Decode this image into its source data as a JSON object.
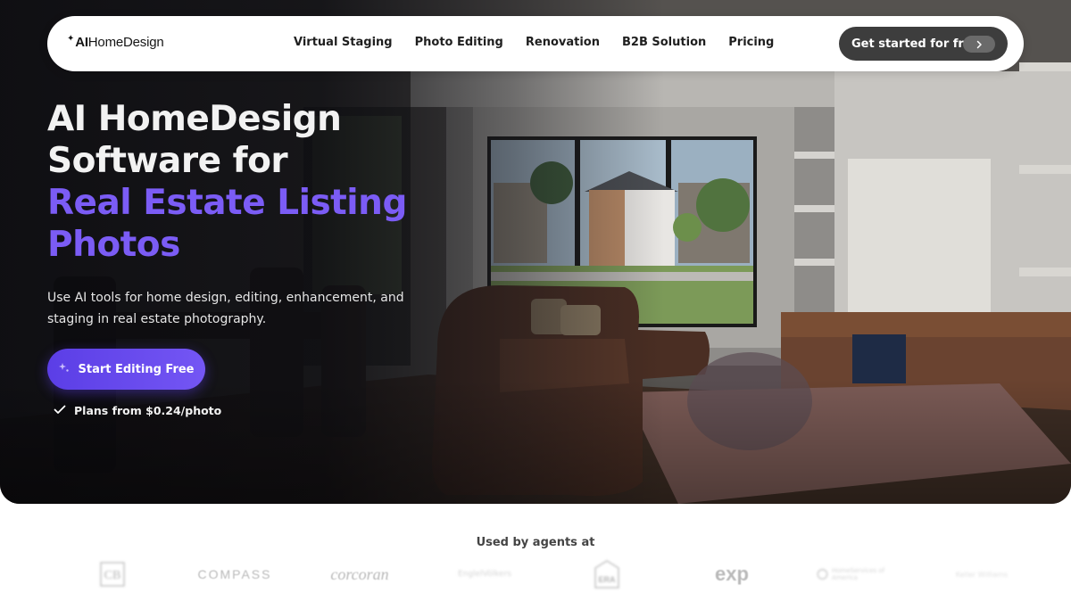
{
  "brand": {
    "logo_prefix": "AI",
    "logo_suffix": "HomeDesign"
  },
  "nav": {
    "items": [
      {
        "label": "Virtual Staging"
      },
      {
        "label": "Photo Editing"
      },
      {
        "label": "Renovation"
      },
      {
        "label": "B2B Solution"
      },
      {
        "label": "Pricing"
      }
    ],
    "cta_label": "Get started for free"
  },
  "hero": {
    "headline_line1": "AI HomeDesign",
    "headline_line2": "Software for",
    "headline_line3": "Real Estate Listing",
    "headline_line4": "Photos",
    "subtext": "Use AI tools for home design, editing, enhancement, and staging in real estate photography.",
    "cta_label": "Start Editing Free",
    "plans_note": "Plans from $0.24/photo"
  },
  "trust": {
    "heading": "Used by agents at",
    "brands": [
      {
        "name": "CB"
      },
      {
        "name": "COMPASS"
      },
      {
        "name": "corcoran"
      },
      {
        "name": "EnglelVölkers"
      },
      {
        "name": "ERA"
      },
      {
        "name": "exp"
      },
      {
        "name": "HomeServices of America"
      },
      {
        "name": "Keller Williams"
      }
    ]
  },
  "colors": {
    "accent": "#7b5cf5",
    "cta_dark": "#3d3d3d",
    "nav_bg": "#ffffff"
  }
}
